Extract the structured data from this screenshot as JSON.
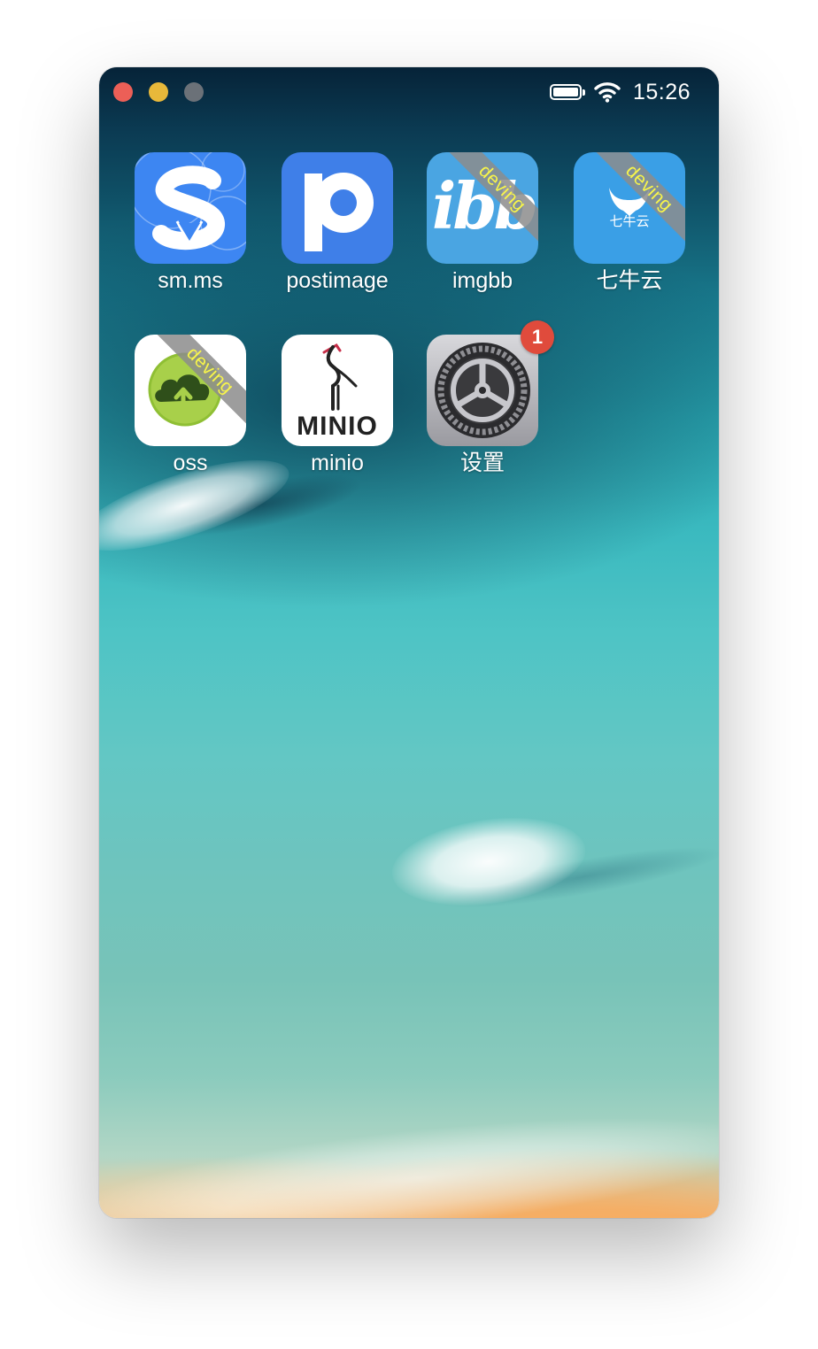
{
  "window": {
    "buttons": [
      "close",
      "minimize",
      "maximize"
    ]
  },
  "status_bar": {
    "battery_icon": "battery-full-icon",
    "wifi_icon": "wifi-icon",
    "time": "15:26"
  },
  "apps": [
    {
      "label": "sm.ms",
      "icon": "smms-logo",
      "ribbon": "",
      "badge": ""
    },
    {
      "label": "postimage",
      "icon": "postimage-logo",
      "ribbon": "",
      "badge": ""
    },
    {
      "label": "imgbb",
      "icon": "imgbb-logo",
      "ribbon": "deving",
      "badge": "",
      "logo_text": "ibb"
    },
    {
      "label": "七牛云",
      "icon": "qiniu-logo",
      "ribbon": "deving",
      "badge": "",
      "logo_text": "七牛云"
    },
    {
      "label": "oss",
      "icon": "oss-cloud-logo",
      "ribbon": "deving",
      "badge": ""
    },
    {
      "label": "minio",
      "icon": "minio-logo",
      "ribbon": "",
      "badge": "",
      "logo_text": "MINIO"
    },
    {
      "label": "设置",
      "icon": "settings-gear-logo",
      "ribbon": "",
      "badge": "1"
    }
  ],
  "colors": {
    "ribbon_text": "#f8f54a",
    "badge": "#e04b3c",
    "smms_bg": "#3d86f2",
    "postimage_bg": "#3f7fe8",
    "imgbb_bg": "#4aa5e2",
    "qiniu_bg": "#3a9fe6"
  }
}
